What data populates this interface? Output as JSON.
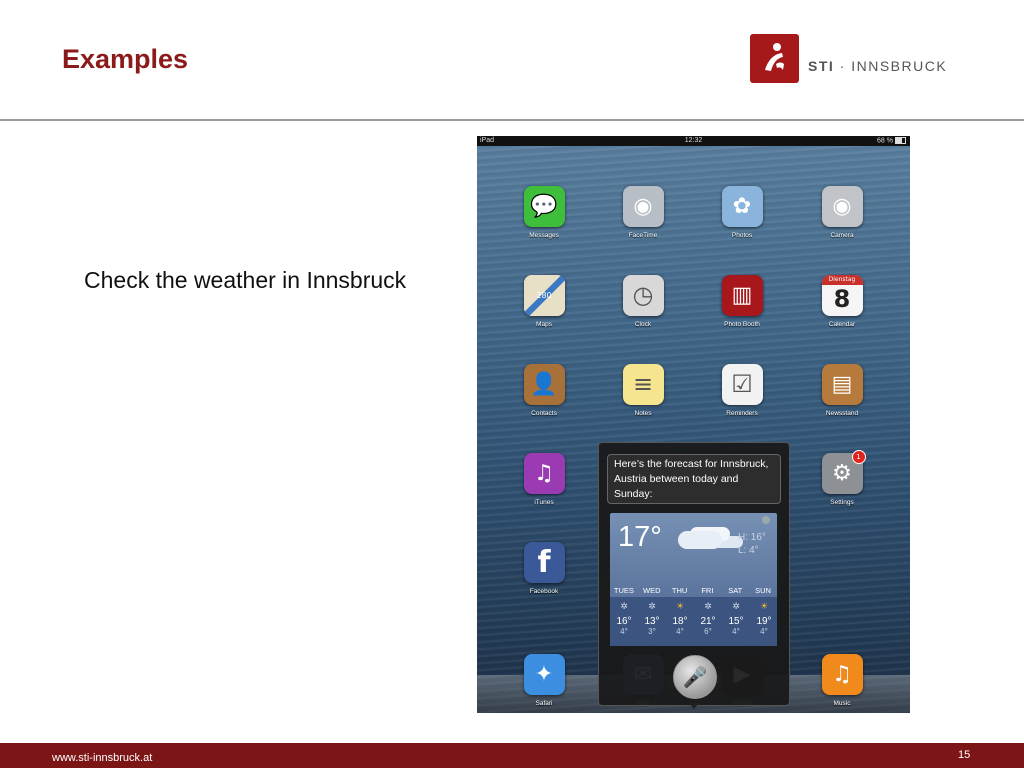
{
  "slide": {
    "title": "Examples",
    "bullet": "Check the weather in Innsbruck",
    "footer_url": "www.sti-innsbruck.at",
    "page_number": "15"
  },
  "logo": {
    "brand_sti": "STI",
    "brand_rest": " · INNSBRUCK",
    "color": "#a5191a"
  },
  "ipad": {
    "status_left": "iPad",
    "status_time": "12:32",
    "status_battery": "68 %",
    "apps": [
      {
        "label": "Messages",
        "icon": "messages-icon",
        "color": "#3fbe3c",
        "glyph": "💬"
      },
      {
        "label": "FaceTime",
        "icon": "facetime-icon",
        "color": "#b8bec6",
        "glyph": "◉"
      },
      {
        "label": "Photos",
        "icon": "photos-icon",
        "color": "#8ab4dc",
        "glyph": "✿"
      },
      {
        "label": "Camera",
        "icon": "camera-icon",
        "color": "#c0c4c8",
        "glyph": "◉"
      },
      {
        "label": "Maps",
        "icon": "maps-icon",
        "color": "#e8dfc7",
        "glyph": "280"
      },
      {
        "label": "Clock",
        "icon": "clock-icon",
        "color": "#d8d8d8",
        "glyph": "◷"
      },
      {
        "label": "Photo Booth",
        "icon": "photo-booth-icon",
        "color": "#a8171c",
        "glyph": "▥"
      },
      {
        "label": "Calendar",
        "icon": "calendar-icon",
        "color": "#f5f5f5",
        "glyph": "8",
        "header": "Dienstag"
      },
      {
        "label": "Contacts",
        "icon": "contacts-icon",
        "color": "#a9713a",
        "glyph": "👤"
      },
      {
        "label": "Notes",
        "icon": "notes-icon",
        "color": "#f6e58f",
        "glyph": "≡"
      },
      {
        "label": "Reminders",
        "icon": "reminders-icon",
        "color": "#f2f2f2",
        "glyph": "☑"
      },
      {
        "label": "Newsstand",
        "icon": "newsstand-icon",
        "color": "#b57a3c",
        "glyph": "▤"
      },
      {
        "label": "iTunes",
        "icon": "itunes-icon",
        "color": "#9b3bb3",
        "glyph": "♫"
      },
      {
        "label": "Settings",
        "icon": "settings-icon",
        "color": "#8d9196",
        "glyph": "⚙",
        "badge": "1"
      },
      {
        "label": "Facebook",
        "icon": "facebook-icon",
        "color": "#3b5998",
        "glyph": "f"
      },
      {
        "label": "Safari",
        "icon": "safari-icon",
        "color": "#3b8ee0",
        "glyph": "✦"
      },
      {
        "label": "Mail",
        "icon": "mail-icon",
        "color": "#4a78b8",
        "glyph": "✉"
      },
      {
        "label": "Videos",
        "icon": "videos-icon",
        "color": "#333333",
        "glyph": "▶"
      },
      {
        "label": "Music",
        "icon": "music-icon",
        "color": "#f08a1c",
        "glyph": "♫"
      }
    ],
    "siri": {
      "response": "Here’s the forecast for Innsbruck, Austria between today and Sunday:",
      "current_temp": "17°",
      "high_label": "H:",
      "high": "16°",
      "low_label": "L:",
      "low": "4°",
      "forecast": [
        {
          "day": "TUES",
          "hi": "16°",
          "lo": "4°",
          "icon": "clear-icon"
        },
        {
          "day": "WED",
          "hi": "13°",
          "lo": "3°",
          "icon": "clear-icon"
        },
        {
          "day": "THU",
          "hi": "18°",
          "lo": "4°",
          "icon": "sunny-icon"
        },
        {
          "day": "FRI",
          "hi": "21°",
          "lo": "6°",
          "icon": "clear-icon"
        },
        {
          "day": "SAT",
          "hi": "15°",
          "lo": "4°",
          "icon": "clear-icon"
        },
        {
          "day": "SUN",
          "hi": "19°",
          "lo": "4°",
          "icon": "sunny-icon"
        }
      ]
    }
  }
}
